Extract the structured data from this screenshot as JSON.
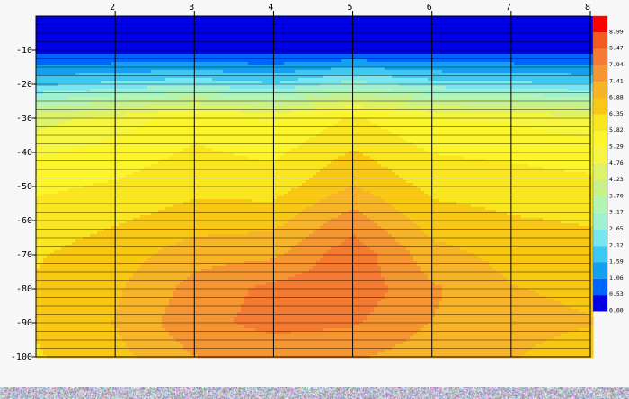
{
  "chart_data": {
    "type": "heatmap",
    "subtype": "filled-contour",
    "x": [
      1,
      2,
      3,
      4,
      5,
      6,
      7,
      8
    ],
    "x_ticks": [
      "2",
      "3",
      "4",
      "5",
      "6",
      "7",
      "8"
    ],
    "xlim": [
      1,
      8
    ],
    "ylim": [
      0,
      -100
    ],
    "y_ticks": [
      "-10",
      "-20",
      "-30",
      "-40",
      "-50",
      "-60",
      "-70",
      "-80",
      "-90",
      "-100"
    ],
    "y_tick_values": [
      -10,
      -20,
      -30,
      -40,
      -50,
      -60,
      -70,
      -80,
      -90,
      -100
    ],
    "grid": true,
    "legend_placement": "right",
    "colorbar": {
      "labels": [
        "8.99",
        "8.47",
        "7.94",
        "7.41",
        "6.88",
        "6.35",
        "5.82",
        "5.29",
        "4.76",
        "4.23",
        "3.70",
        "3.17",
        "2.65",
        "2.12",
        "1.59",
        "1.06",
        "0.53",
        "0.00"
      ],
      "colors": [
        "#ff0000",
        "#f45a1e",
        "#f57a32",
        "#f59632",
        "#f8b428",
        "#f8c814",
        "#fae61e",
        "#fbf52a",
        "#f6f640",
        "#def268",
        "#c8f08c",
        "#b4f5b4",
        "#a0f0d2",
        "#78e6f0",
        "#3cc8f0",
        "#14a0f0",
        "#0064ff",
        "#0000e6"
      ]
    },
    "depth": [
      0,
      -10,
      -20,
      -30,
      -40,
      -50,
      -60,
      -70,
      -80,
      -90,
      -100
    ],
    "values": [
      [
        0.1,
        0.1,
        0.1,
        0.1,
        0.1,
        0.1,
        0.1,
        0.1
      ],
      [
        0.3,
        0.3,
        0.3,
        0.3,
        0.3,
        0.3,
        0.3,
        0.3
      ],
      [
        2.0,
        2.3,
        2.5,
        2.2,
        2.9,
        2.4,
        2.3,
        2.1
      ],
      [
        4.5,
        5.0,
        5.6,
        5.2,
        5.9,
        5.3,
        5.2,
        5.0
      ],
      [
        5.2,
        5.5,
        5.9,
        5.7,
        6.4,
        5.8,
        5.7,
        5.5
      ],
      [
        5.7,
        5.9,
        6.2,
        6.1,
        6.9,
        6.2,
        6.1,
        6.0
      ],
      [
        6.1,
        6.3,
        6.6,
        6.7,
        7.7,
        6.6,
        6.4,
        6.3
      ],
      [
        6.3,
        6.6,
        7.2,
        7.3,
        8.3,
        7.1,
        6.7,
        6.6
      ],
      [
        6.4,
        6.8,
        7.6,
        8.1,
        8.3,
        7.5,
        6.9,
        6.8
      ],
      [
        6.4,
        6.9,
        7.8,
        8.1,
        8.0,
        7.4,
        7.0,
        6.9
      ],
      [
        6.3,
        6.7,
        7.4,
        7.6,
        7.5,
        7.1,
        6.9,
        6.7
      ]
    ]
  }
}
